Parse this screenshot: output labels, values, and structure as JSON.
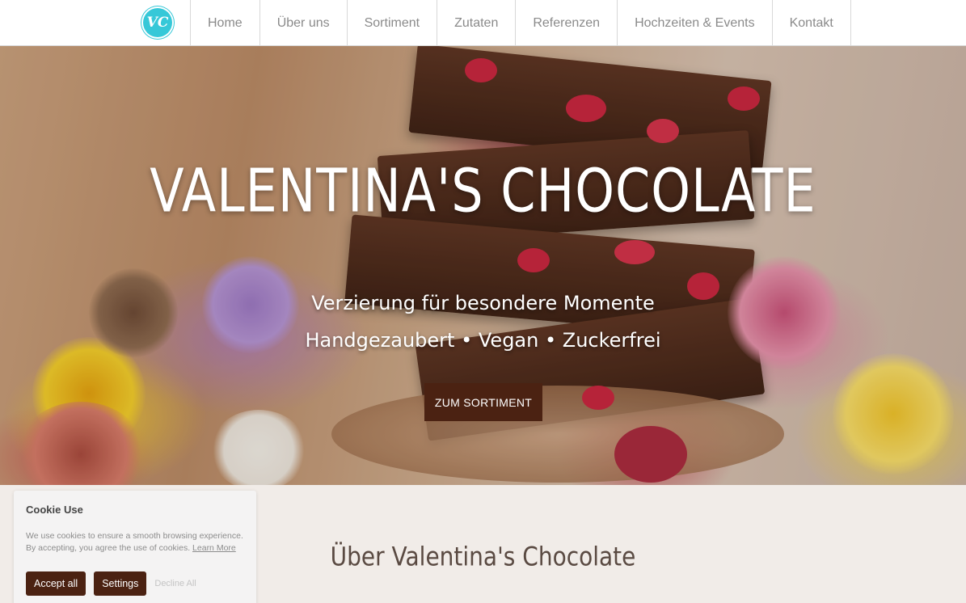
{
  "brand": {
    "logo_text": "VC",
    "logo_color": "#36c8d8"
  },
  "nav": {
    "items": [
      {
        "label": "Home"
      },
      {
        "label": "Über uns"
      },
      {
        "label": "Sortiment"
      },
      {
        "label": "Zutaten"
      },
      {
        "label": "Referenzen"
      },
      {
        "label": "Hochzeiten & Events"
      },
      {
        "label": "Kontakt"
      }
    ]
  },
  "hero": {
    "title": "VALENTINA'S CHOCOLATE",
    "subtitle_line1": "Verzierung für besondere Momente",
    "subtitle_line2": "Handgezaubert • Vegan • Zuckerfrei",
    "cta_label": "ZUM SORTIMENT",
    "accent_color": "#4b2212"
  },
  "about": {
    "title": "Über Valentina's Chocolate"
  },
  "cookie": {
    "title": "Cookie Use",
    "text": "We use cookies to ensure a smooth browsing experience. By accepting, you agree the use of cookies.",
    "learn_more": "Learn More",
    "accept_label": "Accept all",
    "settings_label": "Settings",
    "decline_label": "Decline All"
  }
}
